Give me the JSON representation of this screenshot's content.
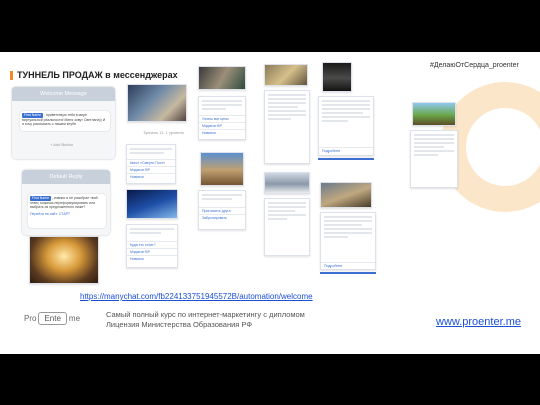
{
  "header": {
    "title": "ТУННЕЛЬ ПРОДАЖ в мессенджерах",
    "hashtag": "#ДелаюОтСердца_proenter"
  },
  "welcome": {
    "heading": "Welcome Message",
    "chip": "First Name",
    "text": ", приветствую тебя в мире виртуальной реальности! Меня зовут Светлана)) И я хочу рассказать о нашем клубе",
    "add_button": "+ Add Button"
  },
  "default_reply": {
    "heading": "Default Reply",
    "chip": "First Name",
    "text": ", извини я не разобрал твой ответ, можешь переформулировать или выбрать из предложенного ниже?",
    "link": "Перейти на сайт: СТАРТ"
  },
  "cards": [
    {
      "lines": [
        "Квест «Смерти Пост»",
        "Мэдисон ВР",
        "Новинки"
      ]
    },
    {
      "lines": [
        "Куда это стоит?",
        "Мэдисон ВР",
        "Новинки"
      ]
    },
    {
      "lines": [
        "Узнать все цены",
        "Мэдисон ВР",
        "Новинки"
      ]
    },
    {
      "lines": [
        "Пригласить друга",
        "Забронировать"
      ]
    },
    {
      "lines": [
        "Подробнее"
      ]
    },
    {
      "lines": [
        "Подробнее"
      ]
    }
  ],
  "small_caption": "Туннель 11: 1 уровень",
  "footer": {
    "link": "https://manychat.com/fb224133751945572B/automation/welcome",
    "logo_left": "Pro",
    "logo_box": "Ente",
    "logo_right": "me",
    "course_line1": "Самый полный курс по интернет-маркетингу с дипломом",
    "course_line2": "Лицензия Министерства Образования РФ",
    "site": "www.proenter.me"
  },
  "colors": {
    "accent": "#f28c28",
    "link": "#1a4fd8",
    "chip": "#3b6fd1",
    "panel_head": "#c8d0dc"
  }
}
